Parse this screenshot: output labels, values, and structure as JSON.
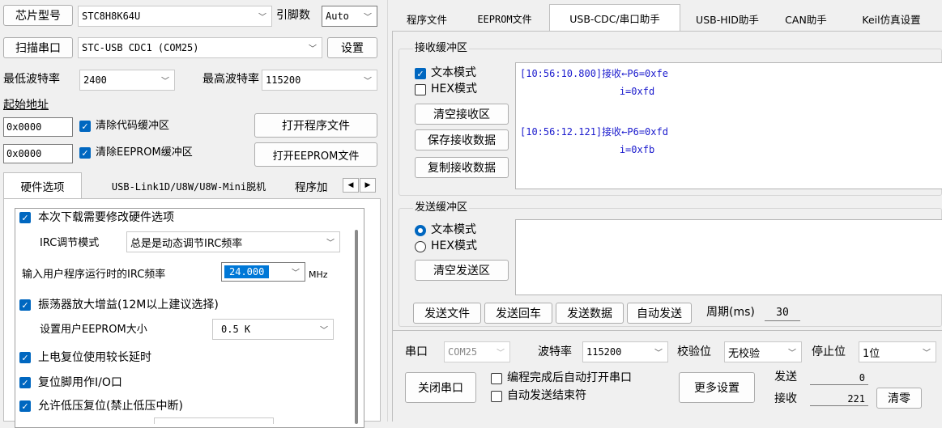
{
  "left": {
    "chip_label": "芯片型号",
    "chip_value": "STC8H8K64U",
    "pin_label": "引脚数",
    "pin_value": "Auto",
    "scan_button": "扫描串口",
    "port_value": "STC-USB CDC1 (COM25)",
    "settings_button": "设置",
    "min_baud_label": "最低波特率",
    "min_baud_value": "2400",
    "max_baud_label": "最高波特率",
    "max_baud_value": "115200",
    "start_addr_label": "起始地址",
    "addr1": "0x0000",
    "clear_code_label": "清除代码缓冲区",
    "open_program_button": "打开程序文件",
    "addr2": "0x0000",
    "clear_eeprom_label": "清除EEPROM缓冲区",
    "open_eeprom_button": "打开EEPROM文件",
    "tabs": [
      "硬件选项",
      "USB-Link1D/U8W/U8W-Mini脱机",
      "程序加"
    ],
    "hw": {
      "modify_hw_label": "本次下载需要修改硬件选项",
      "irc_mode_label": "IRC调节模式",
      "irc_mode_value": "总是是动态调节IRC频率",
      "irc_freq_label": "输入用户程序运行时的IRC频率",
      "irc_freq_value": "24.000",
      "irc_freq_unit": "MHz",
      "osc_gain_label": "振荡器放大增益(12M以上建议选择)",
      "eeprom_size_label": "设置用户EEPROM大小",
      "eeprom_size_value": "0.5 K",
      "power_reset_label": "上电复位使用较长延时",
      "reset_io_label": "复位脚用作I/O口",
      "low_volt_label": "允许低压复位(禁止低压中断)"
    }
  },
  "right": {
    "tabs": [
      "程序文件",
      "EEPROM文件",
      "USB-CDC/串口助手",
      "USB-HID助手",
      "CAN助手",
      "Keil仿真设置"
    ],
    "active_tab": "USB-CDC/串口助手",
    "recv": {
      "title": "接收缓冲区",
      "text_mode": "文本模式",
      "hex_mode": "HEX模式",
      "clear_btn": "清空接收区",
      "save_btn": "保存接收数据",
      "copy_btn": "复制接收数据",
      "lines": [
        "[10:56:10.800]接收←P6=0xfe",
        "                 i=0xfd",
        "",
        "[10:56:12.121]接收←P6=0xfd",
        "                 i=0xfb"
      ]
    },
    "send": {
      "title": "发送缓冲区",
      "text_mode": "文本模式",
      "hex_mode": "HEX模式",
      "clear_btn": "清空发送区",
      "send_file": "发送文件",
      "send_return": "发送回车",
      "send_data": "发送数据",
      "auto_send": "自动发送",
      "period_label": "周期(ms)",
      "period_value": "30"
    },
    "serial": {
      "port_label": "串口",
      "port_value": "COM25",
      "baud_label": "波特率",
      "baud_value": "115200",
      "parity_label": "校验位",
      "parity_value": "无校验",
      "stop_label": "停止位",
      "stop_value": "1位",
      "close_btn": "关闭串口",
      "auto_open_label": "编程完成后自动打开串口",
      "auto_end_label": "自动发送结束符",
      "more_btn": "更多设置",
      "sent_label": "发送",
      "sent_value": "0",
      "recv_label": "接收",
      "recv_value": "221",
      "clear_btn": "清零"
    }
  },
  "colors": {
    "accent": "#0067c0",
    "recv_text": "#1a1acd",
    "selection": "#0078d7"
  }
}
